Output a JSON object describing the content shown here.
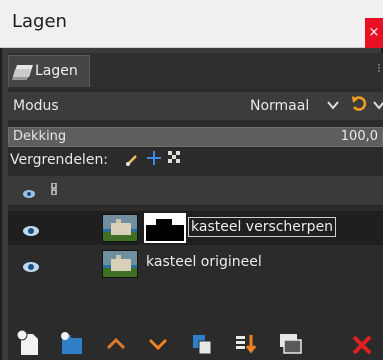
{
  "window": {
    "title": "Lagen",
    "close_glyph": "×"
  },
  "tabs": [
    {
      "label": "Lagen",
      "icon": "layers-icon",
      "menu_glyph": "⁝"
    }
  ],
  "mode": {
    "label": "Modus",
    "value": "Normaal"
  },
  "opacity": {
    "label": "Dekking",
    "value": "100,0"
  },
  "lock": {
    "label": "Vergrendelen:"
  },
  "layers": [
    {
      "name": "kasteel verscherpen",
      "visible": true,
      "has_mask": true,
      "selected": true
    },
    {
      "name": "kasteel origineel",
      "visible": true,
      "has_mask": false,
      "selected": false
    }
  ],
  "footer_buttons": [
    "new-layer-icon",
    "new-layer-group-icon",
    "raise-layer-icon",
    "lower-layer-icon",
    "duplicate-layer-icon",
    "merge-down-icon",
    "add-mask-icon",
    "delete-layer-icon"
  ],
  "colors": {
    "accent_orange": "#f08020",
    "accent_blue": "#3a8be8",
    "delete_red": "#e02020",
    "close_red": "#e81123"
  }
}
